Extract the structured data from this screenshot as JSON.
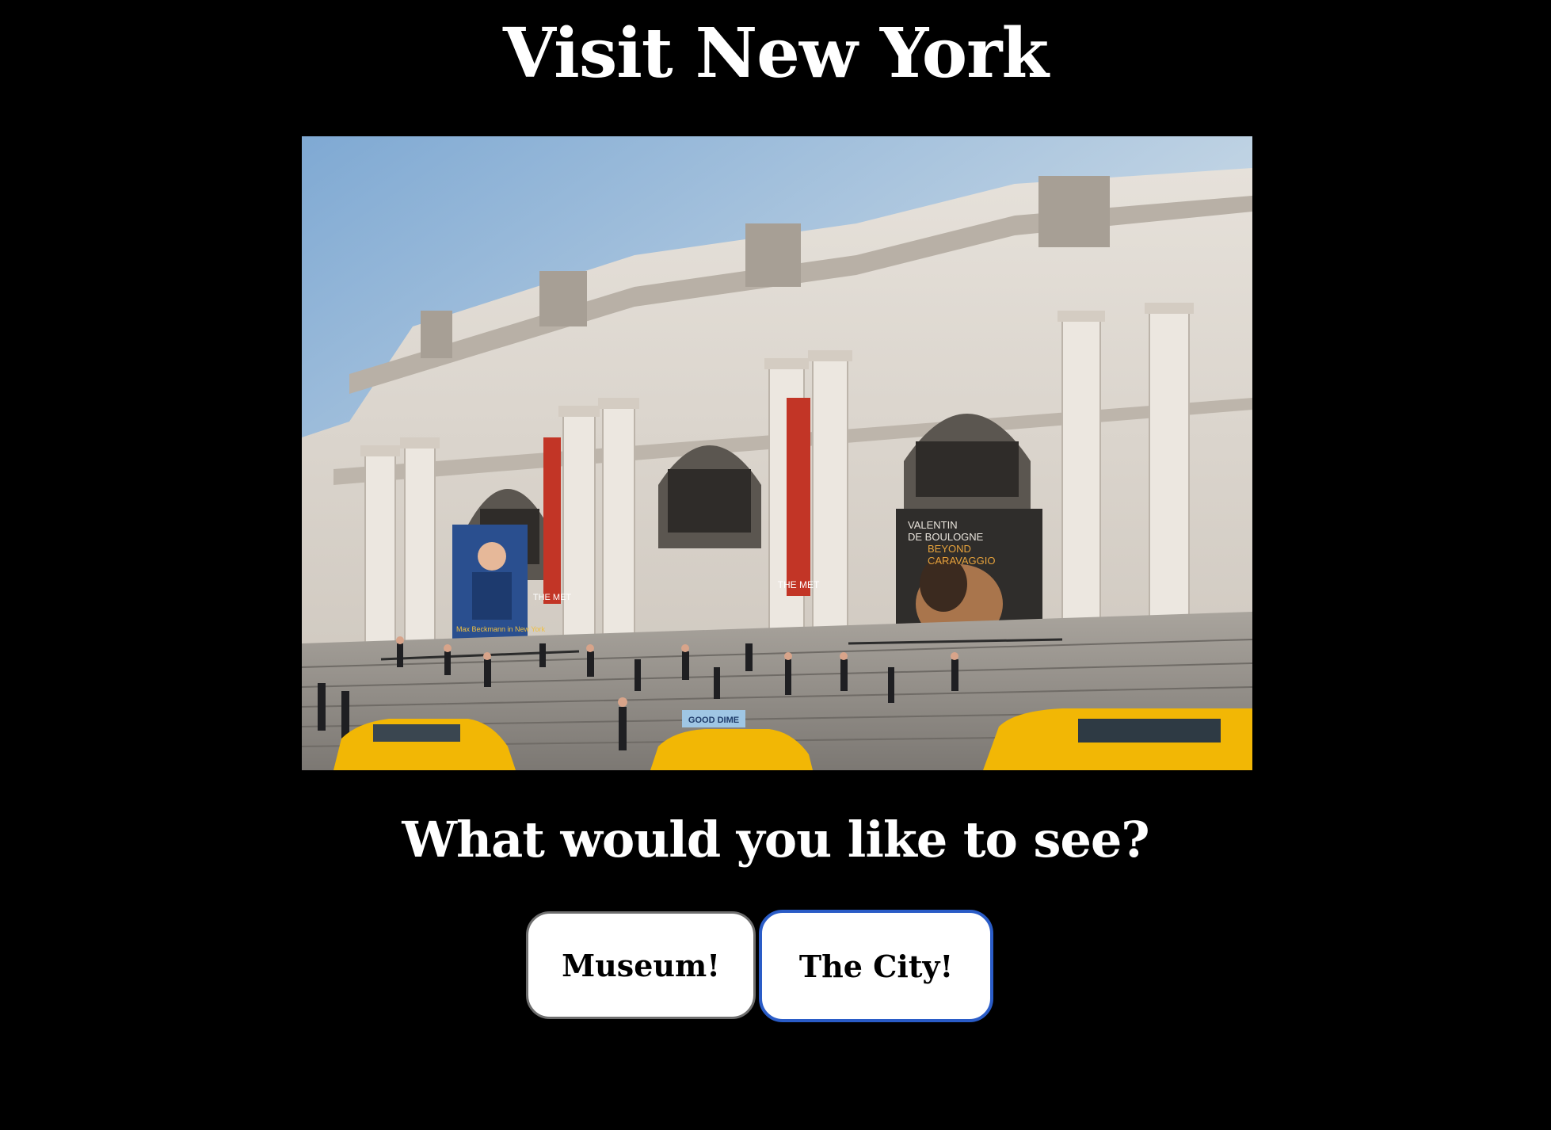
{
  "header": {
    "title": "Visit New York"
  },
  "hero": {
    "banner_left": "Max Beckmann in New York",
    "banner_center_a": "THE MET",
    "banner_center_b": "THE MET",
    "banner_right_line1": "VALENTIN",
    "banner_right_line2": "DE BOULOGNE",
    "banner_right_line3": "BEYOND",
    "banner_right_line4": "CARAVAGGIO",
    "taxi_sign": "GOOD DIME"
  },
  "prompt": {
    "question": "What would you like to see?"
  },
  "choices": {
    "museum_label": "Museum!",
    "city_label": "The City!"
  },
  "colors": {
    "background": "#000000",
    "text": "#ffffff",
    "button_bg": "#ffffff",
    "button_text": "#000000",
    "focus_ring": "#2a5cc7"
  }
}
